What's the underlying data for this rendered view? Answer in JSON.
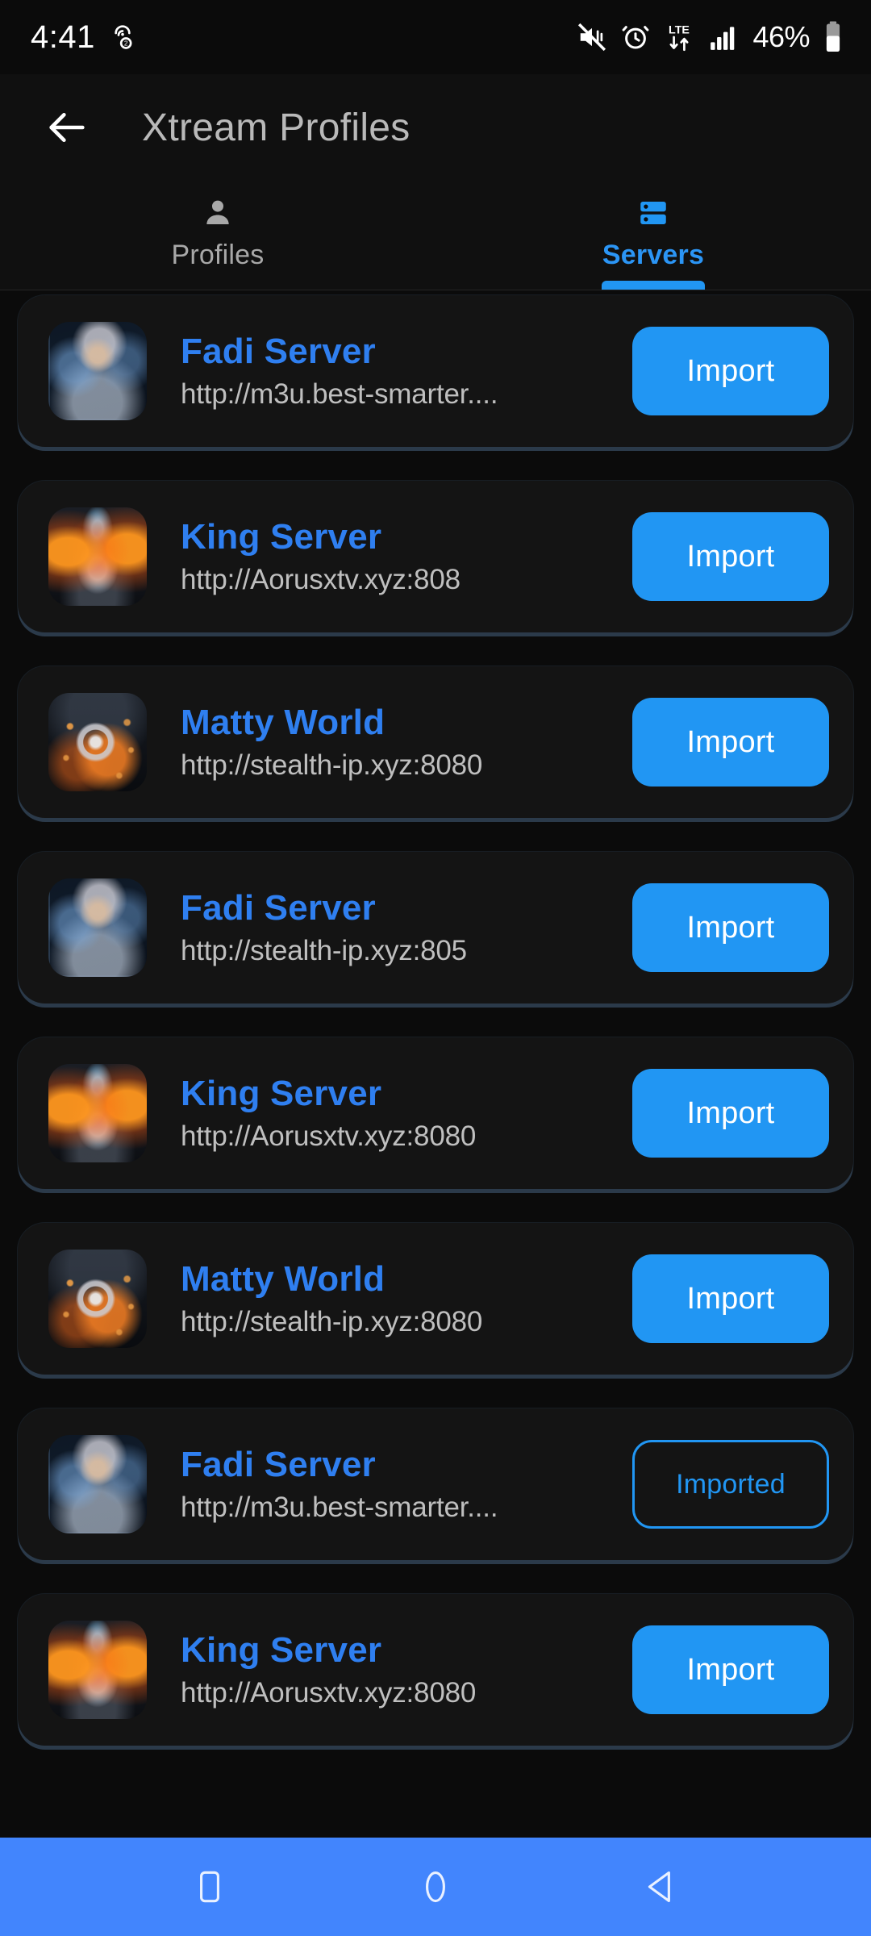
{
  "status_bar": {
    "clock": "4:41",
    "battery_percent": "46%",
    "icons": [
      "signal-dual-sim-icon",
      "mute-vibrate-icon",
      "alarm-icon",
      "lte-data-icon",
      "cellular-signal-icon",
      "battery-icon"
    ]
  },
  "app_bar": {
    "back_icon": "arrow-left-icon",
    "title": "Xtream Profiles"
  },
  "tabs": [
    {
      "label": "Profiles",
      "icon": "person-icon",
      "active": false
    },
    {
      "label": "Servers",
      "icon": "server-rack-icon",
      "active": true
    }
  ],
  "colors": {
    "accent_blue": "#2196f3",
    "name_blue": "#2f7ff0",
    "nav_bar_blue": "#4285fd",
    "card_bg": "#141414",
    "page_bg": "#0b0b0b"
  },
  "servers": [
    {
      "name": "Fadi Server",
      "url": "http://m3u.best-smarter....",
      "avatar": "av-fadi",
      "action": "Import",
      "imported": false
    },
    {
      "name": "King Server",
      "url": "http://Aorusxtv.xyz:808",
      "avatar": "av-king",
      "action": "Import",
      "imported": false
    },
    {
      "name": "Matty World",
      "url": "http://stealth-ip.xyz:8080",
      "avatar": "av-matty",
      "action": "Import",
      "imported": false
    },
    {
      "name": "Fadi Server",
      "url": "http://stealth-ip.xyz:805",
      "avatar": "av-fadi",
      "action": "Import",
      "imported": false
    },
    {
      "name": "King Server",
      "url": "http://Aorusxtv.xyz:8080",
      "avatar": "av-king",
      "action": "Import",
      "imported": false
    },
    {
      "name": "Matty World",
      "url": "http://stealth-ip.xyz:8080",
      "avatar": "av-matty",
      "action": "Import",
      "imported": false
    },
    {
      "name": "Fadi Server",
      "url": "http://m3u.best-smarter....",
      "avatar": "av-fadi",
      "action": "Imported",
      "imported": true
    },
    {
      "name": "King Server",
      "url": "http://Aorusxtv.xyz:8080",
      "avatar": "av-king",
      "action": "Import",
      "imported": false
    }
  ],
  "nav_bar": {
    "recents_icon": "square-recents-icon",
    "home_icon": "circle-home-icon",
    "back_icon": "triangle-back-icon"
  }
}
